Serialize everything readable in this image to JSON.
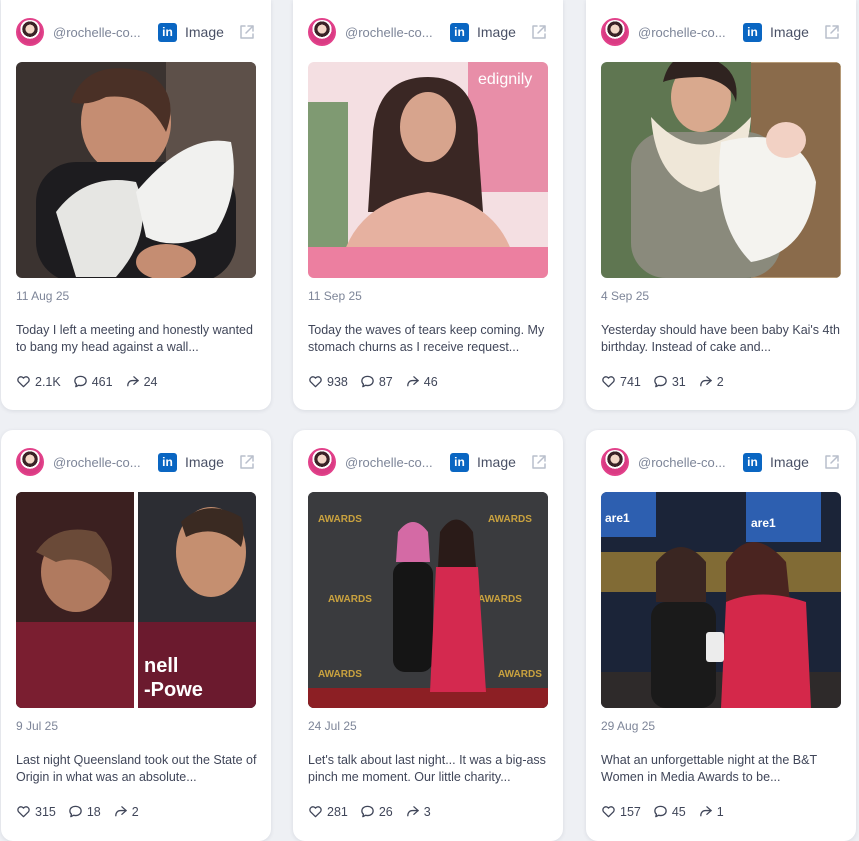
{
  "posts": [
    {
      "handle": "@rochelle-co...",
      "platform": "linkedin",
      "type_label": "Image",
      "date": "11 Aug 25",
      "text": "Today I left a meeting and honestly wanted to bang my head against a wall...",
      "likes": "2.1K",
      "comments": "461",
      "shares": "24"
    },
    {
      "handle": "@rochelle-co...",
      "platform": "linkedin",
      "type_label": "Image",
      "date": "11 Sep 25",
      "text": "Today the waves of tears keep coming. My stomach churns as I receive request...",
      "likes": "938",
      "comments": "87",
      "shares": "46"
    },
    {
      "handle": "@rochelle-co...",
      "platform": "linkedin",
      "type_label": "Image",
      "date": "4 Sep 25",
      "text": "Yesterday should have been baby Kai's 4th birthday. Instead of cake and...",
      "likes": "741",
      "comments": "31",
      "shares": "2"
    },
    {
      "handle": "@rochelle-co...",
      "platform": "linkedin",
      "type_label": "Image",
      "date": "9 Jul 25",
      "text": "Last night Queensland took out the State of Origin in what was an absolute...",
      "likes": "315",
      "comments": "18",
      "shares": "2"
    },
    {
      "handle": "@rochelle-co...",
      "platform": "linkedin",
      "type_label": "Image",
      "date": "24 Jul 25",
      "text": "Let's talk about last night... It was a big-ass pinch me moment. Our little charity...",
      "likes": "281",
      "comments": "26",
      "shares": "3"
    },
    {
      "handle": "@rochelle-co...",
      "platform": "linkedin",
      "type_label": "Image",
      "date": "29 Aug 25",
      "text": "What an unforgettable night at the B&T Women in Media Awards to be...",
      "likes": "157",
      "comments": "45",
      "shares": "1"
    }
  ],
  "colors": {
    "page_bg": "#eef0f4",
    "card_bg": "#ffffff",
    "linkedin": "#0a66c2",
    "muted_text": "#7d8598",
    "body_text": "#404659",
    "avatar_ring": "#e2418a"
  },
  "icons": {
    "platform": "linkedin-icon",
    "external": "external-link-icon",
    "like": "heart-icon",
    "comment": "comment-bubble-icon",
    "share": "share-arrow-icon"
  }
}
